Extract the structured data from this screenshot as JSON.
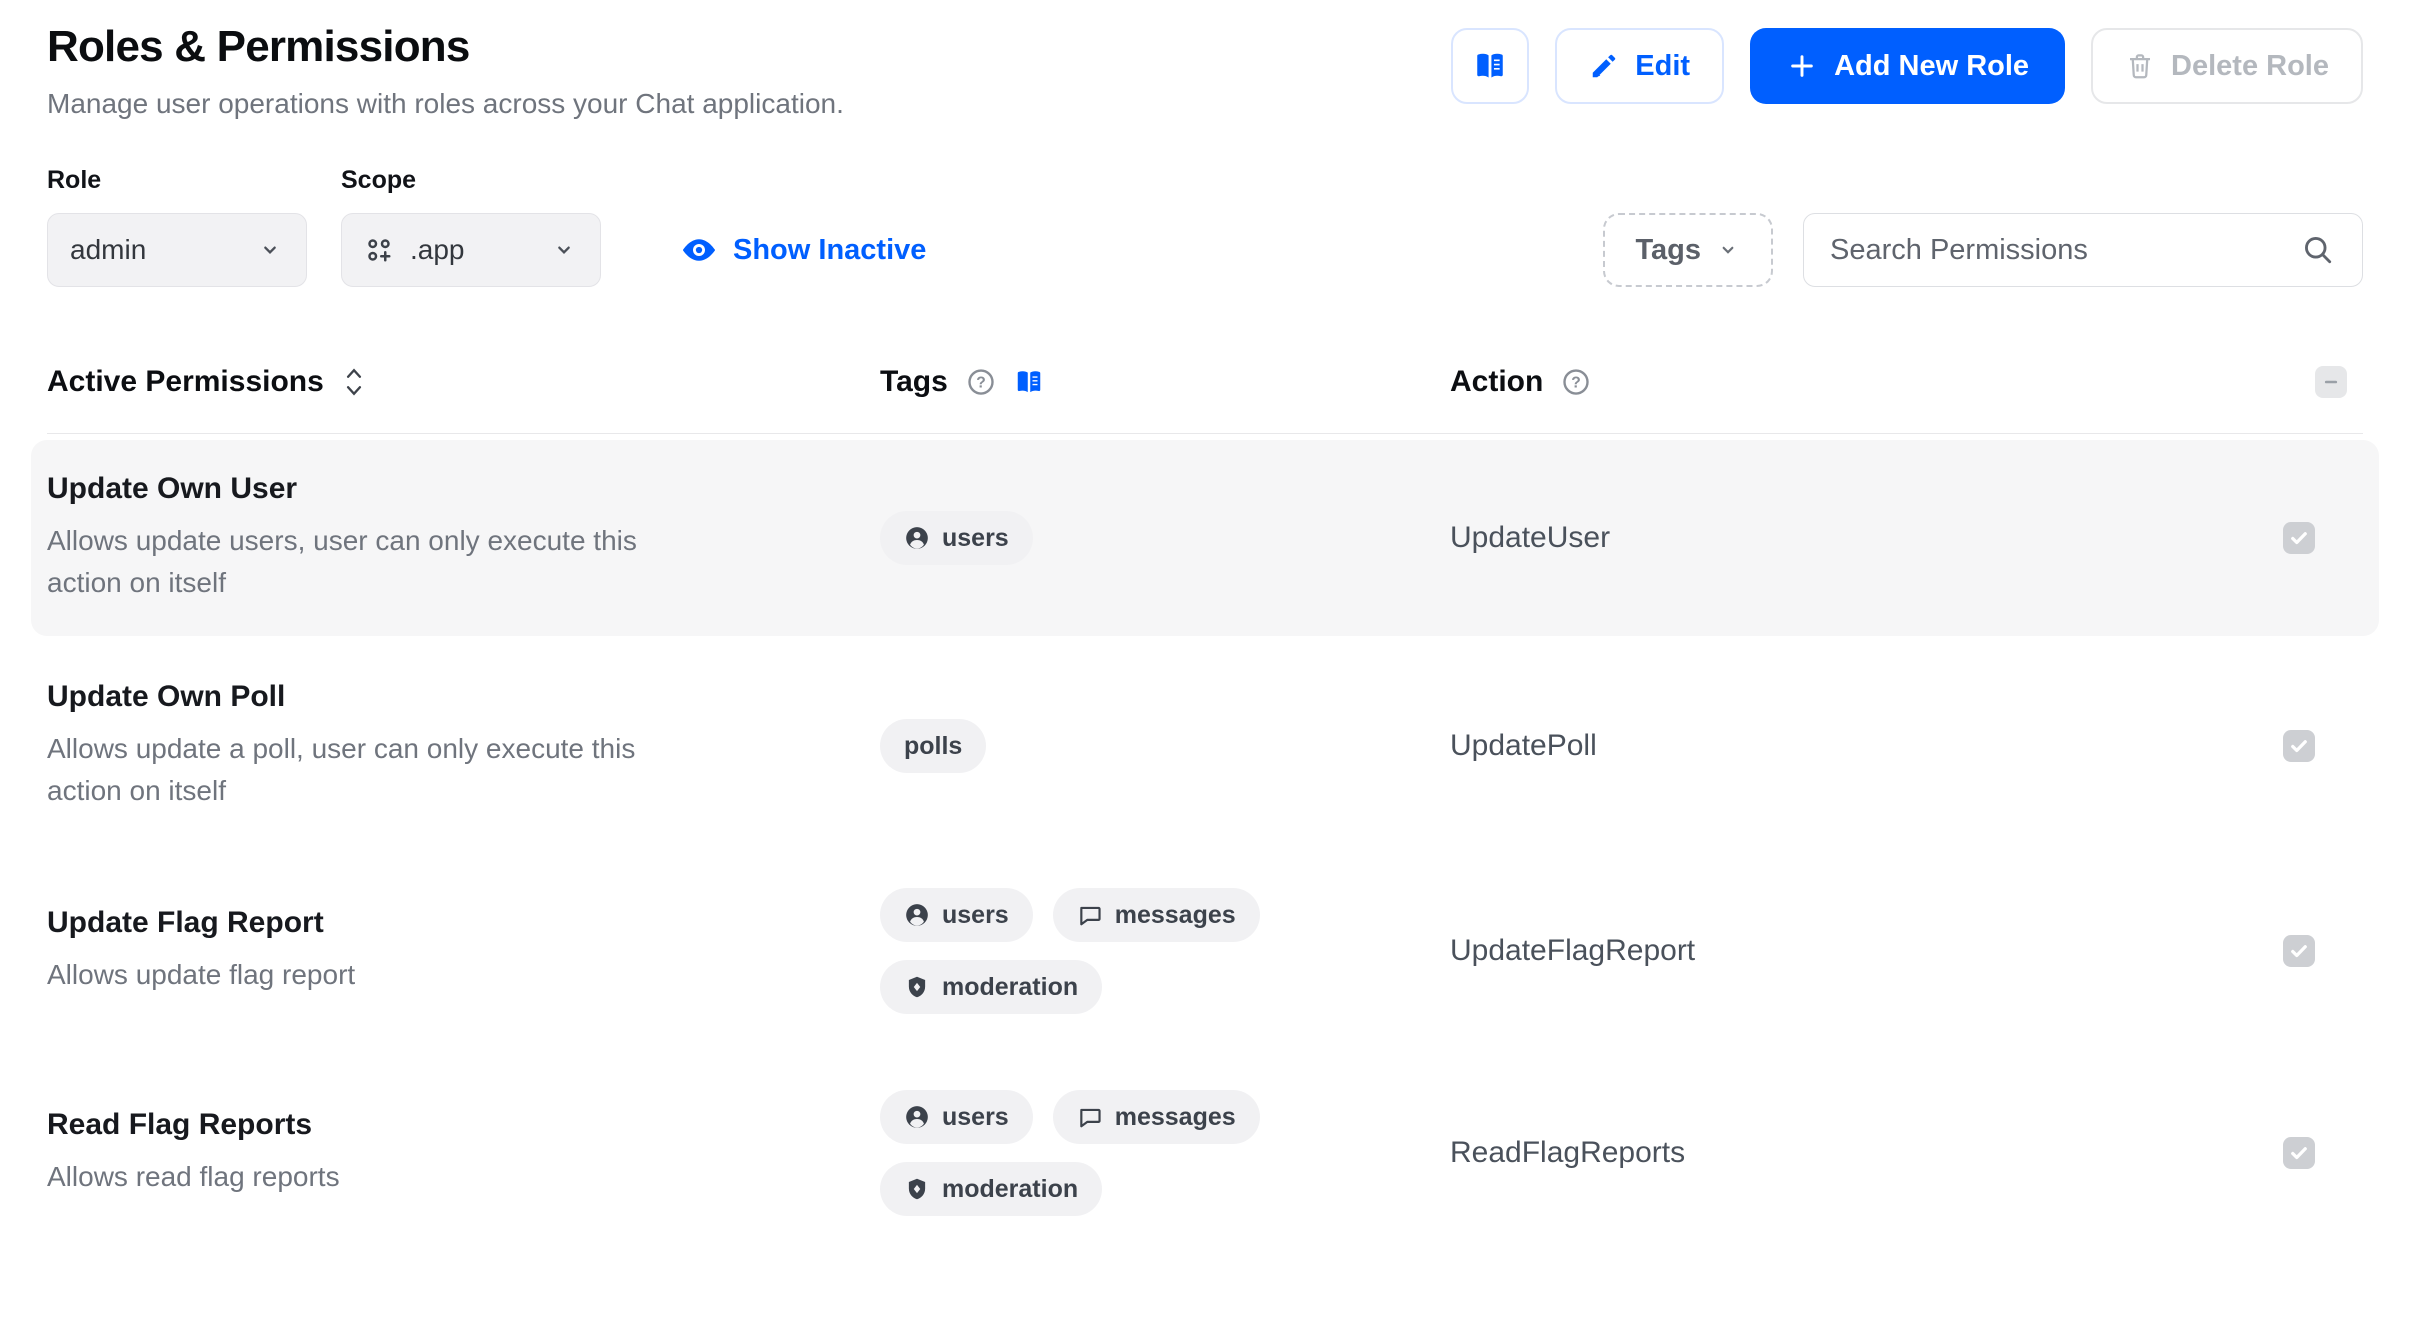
{
  "page": {
    "title": "Roles & Permissions",
    "subtitle": "Manage user operations with roles across your Chat application."
  },
  "toolbar": {
    "docs_button_icon": "book-icon",
    "edit_label": "Edit",
    "add_new_role_label": "Add New Role",
    "delete_role_label": "Delete Role",
    "accent_color": "#005fff"
  },
  "filters": {
    "role_label": "Role",
    "role_value": "admin",
    "scope_label": "Scope",
    "scope_value": ".app",
    "show_inactive_label": "Show Inactive",
    "tags_filter_label": "Tags",
    "search_placeholder": "Search Permissions"
  },
  "table": {
    "header": {
      "permissions": "Active Permissions",
      "tags": "Tags",
      "action": "Action"
    },
    "select_all_state": "indeterminate",
    "rows": [
      {
        "name": "Update Own User",
        "description": "Allows update users, user can only execute this action on itself",
        "tags": [
          {
            "label": "users",
            "icon": "user-icon"
          }
        ],
        "action": "UpdateUser",
        "checked": true,
        "highlighted": true
      },
      {
        "name": "Update Own Poll",
        "description": "Allows update a poll, user can only execute this action on itself",
        "tags": [
          {
            "label": "polls",
            "icon": null
          }
        ],
        "action": "UpdatePoll",
        "checked": true,
        "highlighted": false
      },
      {
        "name": "Update Flag Report",
        "description": "Allows update flag report",
        "tags": [
          {
            "label": "users",
            "icon": "user-icon"
          },
          {
            "label": "messages",
            "icon": "message-icon"
          },
          {
            "label": "moderation",
            "icon": "shield-icon"
          }
        ],
        "action": "UpdateFlagReport",
        "checked": true,
        "highlighted": false
      },
      {
        "name": "Read Flag Reports",
        "description": "Allows read flag reports",
        "tags": [
          {
            "label": "users",
            "icon": "user-icon"
          },
          {
            "label": "messages",
            "icon": "message-icon"
          },
          {
            "label": "shield-moderation",
            "icon": "shield-icon",
            "label_override": "moderation"
          }
        ],
        "action": "ReadFlagReports",
        "checked": true,
        "highlighted": false
      }
    ]
  },
  "colors": {
    "accent": "#005fff",
    "row_highlight": "#f6f6f7",
    "chip_bg": "#f1f1f3",
    "checkbox_gray": "#cdcfd3",
    "disabled_text": "#b4b8be"
  }
}
